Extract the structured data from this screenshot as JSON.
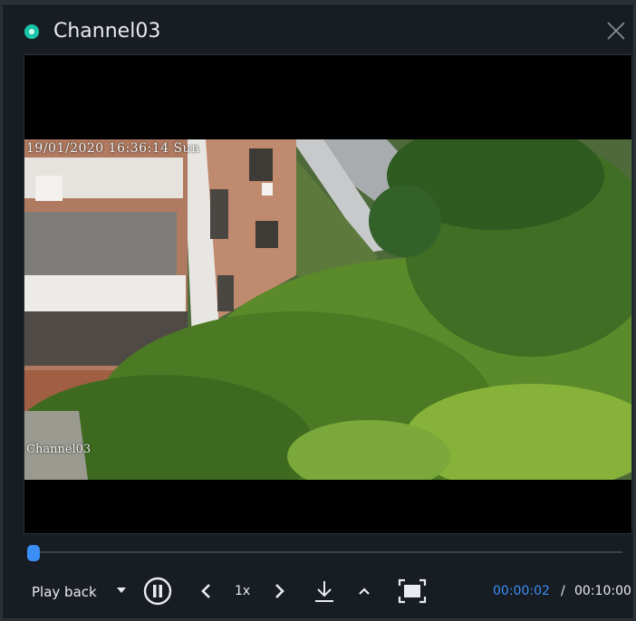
{
  "window": {
    "title": "Channel03",
    "status_color": "#19c5a6",
    "close_icon": "close-icon"
  },
  "video": {
    "osd_timestamp": "19/01/2020 16:36:14 Sun",
    "osd_channel": "Channel03"
  },
  "playback": {
    "progress_fraction": 0.0033,
    "mode_label": "Play back",
    "speed": "1x",
    "current_time": "00:00:02",
    "separator": "/",
    "total_time": "00:10:00"
  },
  "colors": {
    "accent": "#3a8ef6",
    "background": "#181c23",
    "text": "#e8ecf1"
  },
  "icons": {
    "mode_dropdown": "caret-down-icon",
    "pause": "pause-icon",
    "previous": "chevron-left-icon",
    "next": "chevron-right-icon",
    "download": "download-icon",
    "up": "chevron-up-icon",
    "fullscreen": "fullscreen-icon"
  }
}
